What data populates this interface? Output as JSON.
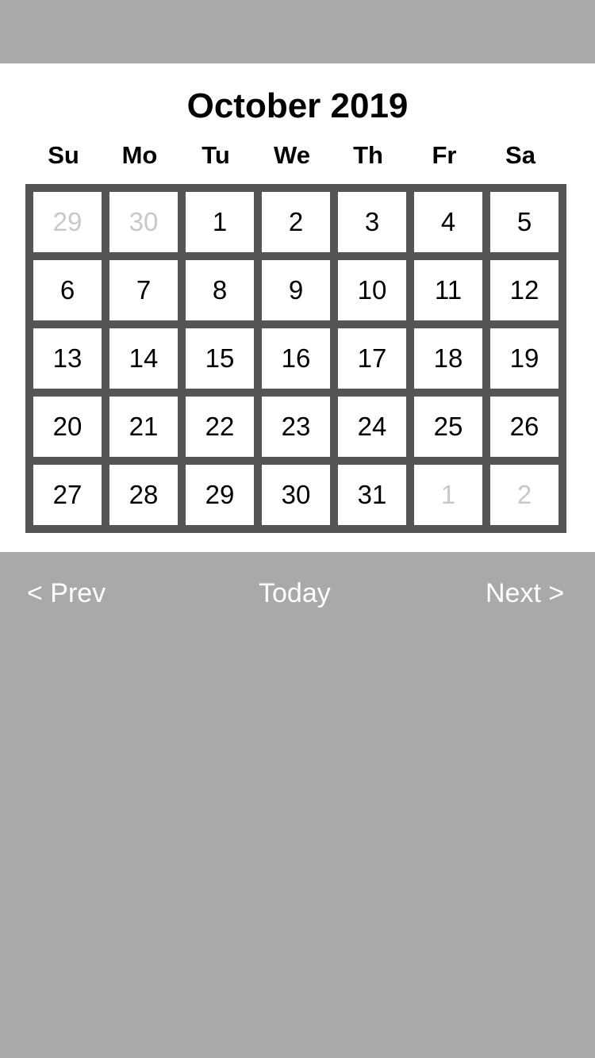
{
  "calendar": {
    "month_title": "October 2019",
    "weekdays": [
      "Su",
      "Mo",
      "Tu",
      "We",
      "Th",
      "Fr",
      "Sa"
    ],
    "weeks": [
      [
        {
          "day": "29",
          "outside": true
        },
        {
          "day": "30",
          "outside": true
        },
        {
          "day": "1"
        },
        {
          "day": "2"
        },
        {
          "day": "3"
        },
        {
          "day": "4"
        },
        {
          "day": "5"
        }
      ],
      [
        {
          "day": "6"
        },
        {
          "day": "7"
        },
        {
          "day": "8"
        },
        {
          "day": "9"
        },
        {
          "day": "10"
        },
        {
          "day": "11"
        },
        {
          "day": "12"
        }
      ],
      [
        {
          "day": "13"
        },
        {
          "day": "14"
        },
        {
          "day": "15"
        },
        {
          "day": "16"
        },
        {
          "day": "17"
        },
        {
          "day": "18"
        },
        {
          "day": "19"
        }
      ],
      [
        {
          "day": "20"
        },
        {
          "day": "21"
        },
        {
          "day": "22"
        },
        {
          "day": "23"
        },
        {
          "day": "24"
        },
        {
          "day": "25"
        },
        {
          "day": "26"
        }
      ],
      [
        {
          "day": "27"
        },
        {
          "day": "28"
        },
        {
          "day": "29"
        },
        {
          "day": "30"
        },
        {
          "day": "31"
        },
        {
          "day": "1",
          "outside": true
        },
        {
          "day": "2",
          "outside": true
        }
      ]
    ]
  },
  "navigation": {
    "prev_label": "< Prev",
    "today_label": "Today",
    "next_label": "Next >"
  },
  "colors": {
    "background": "#a9a9a9",
    "panel": "#ffffff",
    "grid_border": "#555555",
    "outside_day_text": "#c8c8c8"
  }
}
